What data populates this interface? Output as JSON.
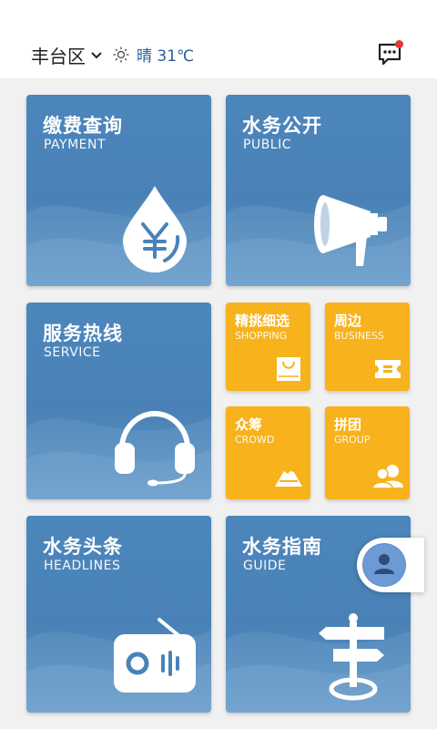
{
  "header": {
    "location": "丰台区",
    "weather": "晴 31℃",
    "icons": {
      "location_dropdown": "chevron-down-icon",
      "weather": "sun-icon",
      "messages": "message-icon"
    },
    "notification_color": "#e53935"
  },
  "tiles": {
    "payment": {
      "title": "缴费查询",
      "subtitle": "PAYMENT",
      "icon": "water-drop-yuan-icon"
    },
    "public": {
      "title": "水务公开",
      "subtitle": "PUBLIC",
      "icon": "megaphone-icon"
    },
    "service": {
      "title": "服务热线",
      "subtitle": "SERVICE",
      "icon": "headset-icon"
    },
    "shopping": {
      "title": "精挑细选",
      "subtitle": "SHOPPING",
      "icon": "shopping-bag-icon"
    },
    "business": {
      "title": "周边",
      "subtitle": "BUSINESS",
      "icon": "ticket-icon"
    },
    "crowd": {
      "title": "众筹",
      "subtitle": "CROWD",
      "icon": "mountain-icon"
    },
    "group": {
      "title": "拼团",
      "subtitle": "GROUP",
      "icon": "group-icon"
    },
    "headlines": {
      "title": "水务头条",
      "subtitle": "HEADLINES",
      "icon": "radio-icon"
    },
    "guide": {
      "title": "水务指南",
      "subtitle": "GUIDE",
      "icon": "signpost-icon"
    }
  },
  "floating": {
    "icon": "user-avatar-icon"
  },
  "colors": {
    "tile_blue": "#4a82b7",
    "tile_yellow": "#f7b21c",
    "weather_text": "#2b5d9b"
  }
}
